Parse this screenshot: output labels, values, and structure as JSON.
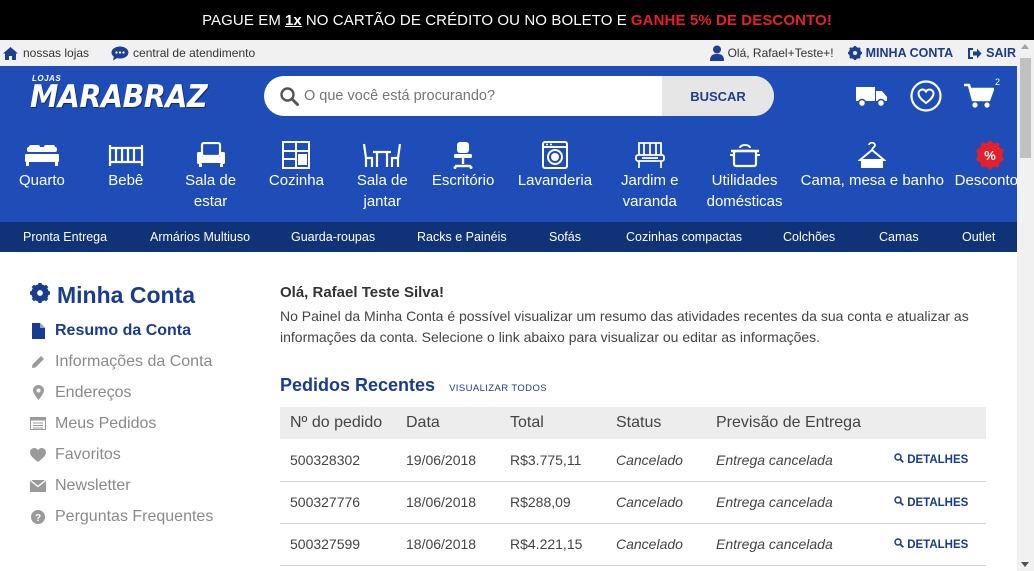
{
  "promo": {
    "text_pre": "PAGUE EM",
    "text_x": "1x",
    "text_mid": "NO CARTÃO DE CRÉDITO OU NO BOLETO E",
    "text_hl": "GANHE 5% DE DESCONTO!"
  },
  "util": {
    "stores": "nossas lojas",
    "service": "central de atendimento",
    "greeting": "Olá, Rafael+Teste+!",
    "account": "MINHA CONTA",
    "logout": "SAIR"
  },
  "header": {
    "logo_small": "LOJAS",
    "logo_big": "MARABRAZ",
    "search_placeholder": "O que você está procurando?",
    "search_button": "BUSCAR",
    "cart_count": "2"
  },
  "categories": [
    {
      "label": "Quarto",
      "icon": "bed-icon"
    },
    {
      "label": "Bebê",
      "icon": "crib-icon"
    },
    {
      "label": "Sala de estar",
      "icon": "armchair-icon"
    },
    {
      "label": "Cozinha",
      "icon": "kitchen-icon"
    },
    {
      "label": "Sala de jantar",
      "icon": "dining-table-icon"
    },
    {
      "label": "Escritório",
      "icon": "office-chair-icon"
    },
    {
      "label": "Lavanderia",
      "icon": "washing-machine-icon"
    },
    {
      "label": "Jardim e varanda",
      "icon": "garden-bench-icon"
    },
    {
      "label": "Utilidades domésticas",
      "icon": "pot-icon"
    },
    {
      "label": "Cama, mesa e banho",
      "icon": "hanger-icon"
    },
    {
      "label": "Descontos",
      "icon": "discount-icon"
    }
  ],
  "subnav": [
    "Pronta Entrega",
    "Armários Multiuso",
    "Guarda-roupas",
    "Racks e Painéis",
    "Sofás",
    "Cozinhas compactas",
    "Colchões",
    "Camas",
    "Outlet"
  ],
  "sidebar": {
    "title": "Minha Conta",
    "items": [
      {
        "label": "Resumo da Conta",
        "icon": "document-icon"
      },
      {
        "label": "Informações da Conta",
        "icon": "pencil-icon"
      },
      {
        "label": "Endereços",
        "icon": "map-pin-icon"
      },
      {
        "label": "Meus Pedidos",
        "icon": "list-icon"
      },
      {
        "label": "Favoritos",
        "icon": "heart-icon"
      },
      {
        "label": "Newsletter",
        "icon": "envelope-icon"
      },
      {
        "label": "Perguntas Frequentes",
        "icon": "question-icon"
      }
    ]
  },
  "main": {
    "greeting": "Olá, Rafael Teste Silva!",
    "intro": "No Painel da Minha Conta é possível visualizar um resumo das atividades recentes da sua conta e atualizar as informações da conta. Selecione o link abaixo para visualizar ou editar as informações.",
    "orders_title": "Pedidos Recentes",
    "view_all": "VISUALIZAR TODOS",
    "columns": [
      "Nº do pedido",
      "Data",
      "Total",
      "Status",
      "Previsão de Entrega"
    ],
    "orders": [
      {
        "id": "500328302",
        "date": "19/06/2018",
        "total": "R$3.775,11",
        "status": "Cancelado",
        "delivery": "Entrega cancelada",
        "action": "DETALHES"
      },
      {
        "id": "500327776",
        "date": "18/06/2018",
        "total": "R$288,09",
        "status": "Cancelado",
        "delivery": "Entrega cancelada",
        "action": "DETALHES"
      },
      {
        "id": "500327599",
        "date": "18/06/2018",
        "total": "R$4.221,15",
        "status": "Cancelado",
        "delivery": "Entrega cancelada",
        "action": "DETALHES"
      }
    ]
  },
  "colors": {
    "brand_blue": "#1e4db7",
    "dark_blue": "#103377",
    "text_blue": "#1a3c8f",
    "promo_red": "#e4202a",
    "discount_red": "#e4202a"
  }
}
